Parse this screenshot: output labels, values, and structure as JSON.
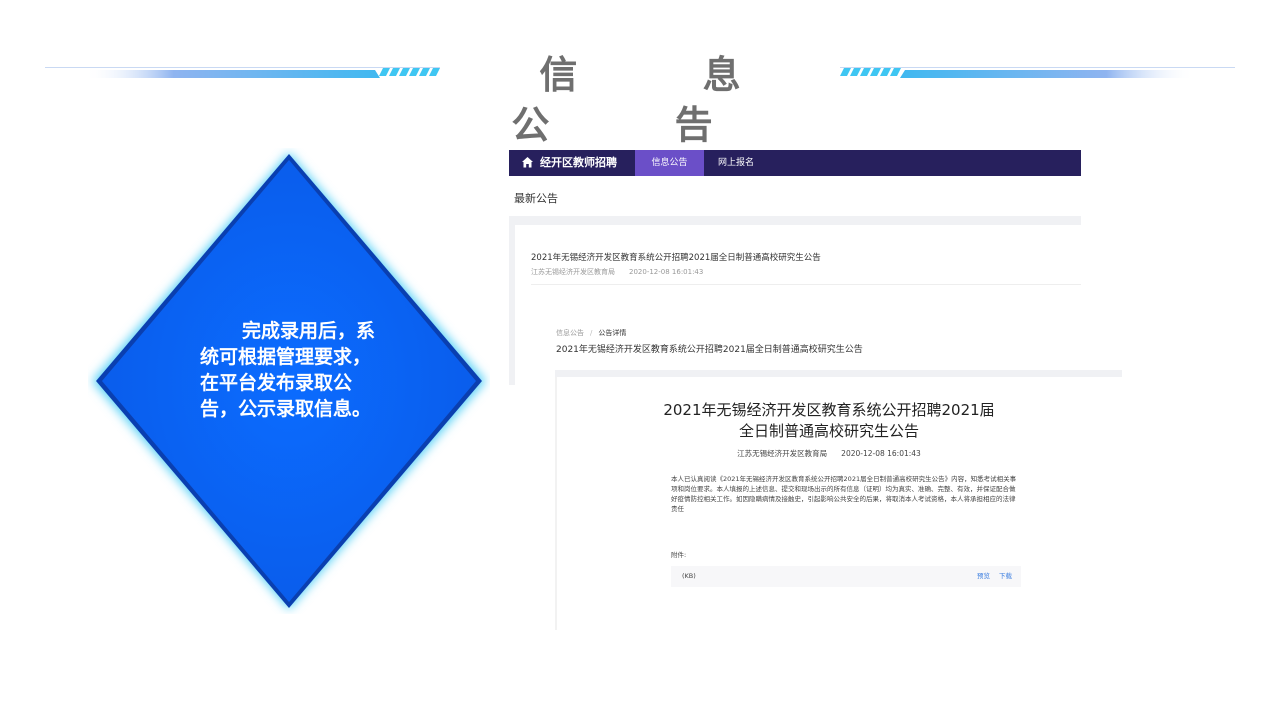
{
  "slide": {
    "title": "信  息  公  告"
  },
  "diamond": {
    "text": "完成录用后，系统可根据管理要求，在平台发布录取公告，公示录取信息。"
  },
  "navbar": {
    "home_icon": "home-icon",
    "brand": "经开区教师招聘",
    "tabs": [
      {
        "label": "信息公告",
        "active": true
      },
      {
        "label": "网上报名",
        "active": false
      }
    ],
    "background": "#27205d",
    "active_color": "#6b4fc8"
  },
  "list_page": {
    "section_title": "最新公告",
    "items": [
      {
        "title": "2021年无锡经济开发区教育系统公开招聘2021届全日制普通高校研究生公告",
        "publisher": "江苏无锡经济开发区教育局",
        "date": "2020-12-08 16:01:43"
      }
    ]
  },
  "detail_page": {
    "breadcrumb": {
      "parent": "信息公告",
      "separator": "/",
      "current": "公告详情"
    },
    "heading": "2021年无锡经济开发区教育系统公开招聘2021届全日制普通高校研究生公告",
    "doc_title": "2021年无锡经济开发区教育系统公开招聘2021届全日制普通高校研究生公告",
    "publisher": "江苏无锡经济开发区教育局",
    "date": "2020-12-08 16:01:43",
    "body": "本人已认真阅读《2021年无锡经济开发区教育系统公开招聘2021届全日制普通高校研究生公告》内容，知悉考试相关事项和岗位要求。本人填报的上述信息、提交和现场出示的所有信息（证明）均为真实、准确、完整、有效，并保证配合做好疫情防控相关工作。如因隐瞒病情及接触史，引起影响公共安全的后果，将取消本人考试资格，本人将承担相应的法律责任",
    "attachment_label": "附件:",
    "attachment_size": "(KB)",
    "preview_label": "预览",
    "download_label": "下载",
    "link_color": "#3d7fe0"
  },
  "colors": {
    "diamond_fill": "#0a66ff",
    "diamond_glow": "#35c8f5",
    "title_text": "#6f6f6f"
  }
}
